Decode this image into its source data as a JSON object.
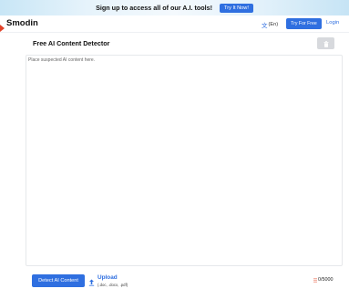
{
  "promo": {
    "text": "Sign up to access all of our A.I. tools!",
    "button_label": "Try It Now!"
  },
  "header": {
    "logo_text": "Smodin",
    "language_label": "(En)",
    "try_free_label": "Try For Free",
    "login_label": "Login"
  },
  "main": {
    "title": "Free AI Content Detector",
    "editor_placeholder": "Place suspected AI content here."
  },
  "footer": {
    "detect_label": "Detect AI Content",
    "upload_label": "Upload",
    "upload_hint": "(.doc, .docx, .pdf)",
    "char_count": "0/5000"
  },
  "colors": {
    "accent": "#2f6fe0",
    "promo_bg": "#d6ecf8",
    "disabled_button": "#d7d9dd"
  },
  "icons": {
    "logo": "smodin-logo-icon",
    "language": "translate-icon",
    "delete": "trash-icon",
    "upload": "upload-icon",
    "counter": "stack-icon"
  }
}
